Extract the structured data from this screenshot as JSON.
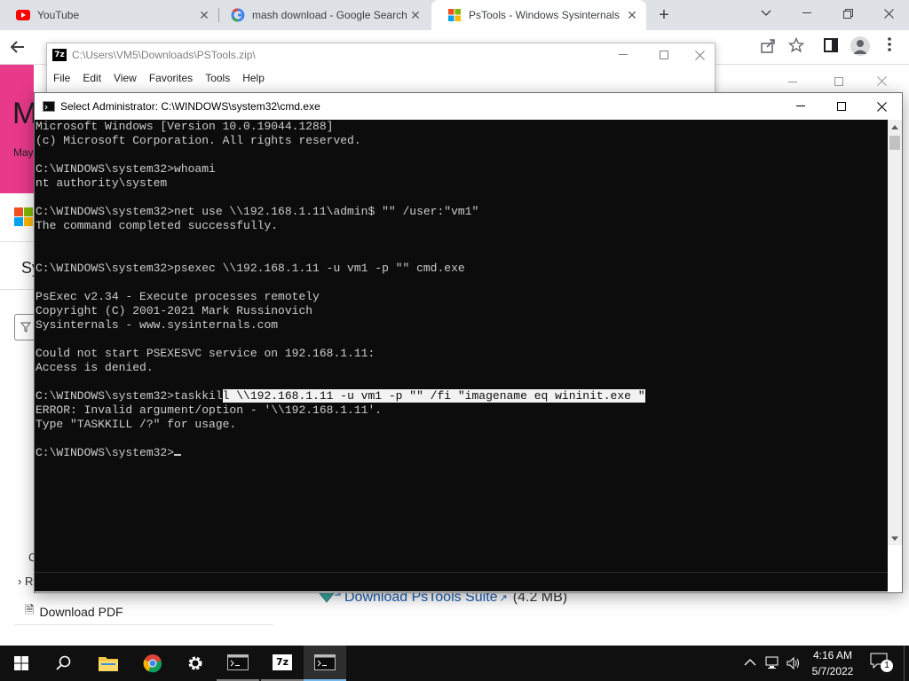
{
  "browser": {
    "tabs": [
      {
        "label": "YouTube",
        "close": "✕"
      },
      {
        "label": "mash download - Google Search",
        "close": "✕"
      },
      {
        "label": "PsTools - Windows Sysinternals |",
        "close": "✕",
        "active": true
      }
    ],
    "new_tab": "+",
    "page_behind": {
      "banner_letter": "M",
      "banner_sub": "May",
      "side_label_s": "Sy",
      "side_c": "C",
      "side_r": "R"
    },
    "download_suite": {
      "label": "Download PsTools Suite",
      "size": "(4.2 MB)"
    },
    "download_pdf": "Download PDF"
  },
  "sevenzip": {
    "title": "C:\\Users\\VM5\\Downloads\\PSTools.zip\\",
    "icon_text": "7z",
    "menu": [
      "File",
      "Edit",
      "View",
      "Favorites",
      "Tools",
      "Help"
    ]
  },
  "cmd": {
    "title": "Select Administrator: C:\\WINDOWS\\system32\\cmd.exe",
    "lines": [
      "Microsoft Windows [Version 10.0.19044.1288]",
      "(c) Microsoft Corporation. All rights reserved.",
      "",
      "C:\\WINDOWS\\system32>whoami",
      "nt authority\\system",
      "",
      "C:\\WINDOWS\\system32>net use \\\\192.168.1.11\\admin$ \"\" /user:\"vm1\"",
      "The command completed successfully.",
      "",
      "",
      "C:\\WINDOWS\\system32>psexec \\\\192.168.1.11 -u vm1 -p \"\" cmd.exe",
      "",
      "PsExec v2.34 - Execute processes remotely",
      "Copyright (C) 2001-2021 Mark Russinovich",
      "Sysinternals - www.sysinternals.com",
      "",
      "Could not start PSEXESVC service on 192.168.1.11:",
      "Access is denied.",
      ""
    ],
    "taskkill_prefix": "C:\\WINDOWS\\system32>taskkil",
    "taskkill_selected": "l \\\\192.168.1.11 -u vm1 -p \"\" /fi \"imagename eq wininit.exe \"",
    "lines_after": [
      "ERROR: Invalid argument/option - '\\\\192.168.1.11'.",
      "Type \"TASKKILL /?\" for usage.",
      ""
    ],
    "prompt": "C:\\WINDOWS\\system32>"
  },
  "taskbar": {
    "time": "4:16 AM",
    "date": "5/7/2022",
    "notification_count": "1",
    "sevenzip_label": "7z"
  },
  "colors": {
    "console_bg": "#0c0c0c",
    "console_fg": "#cccccc",
    "taskbar_bg": "#101010",
    "link": "#1a5fb4",
    "banner": "#e8398a"
  }
}
